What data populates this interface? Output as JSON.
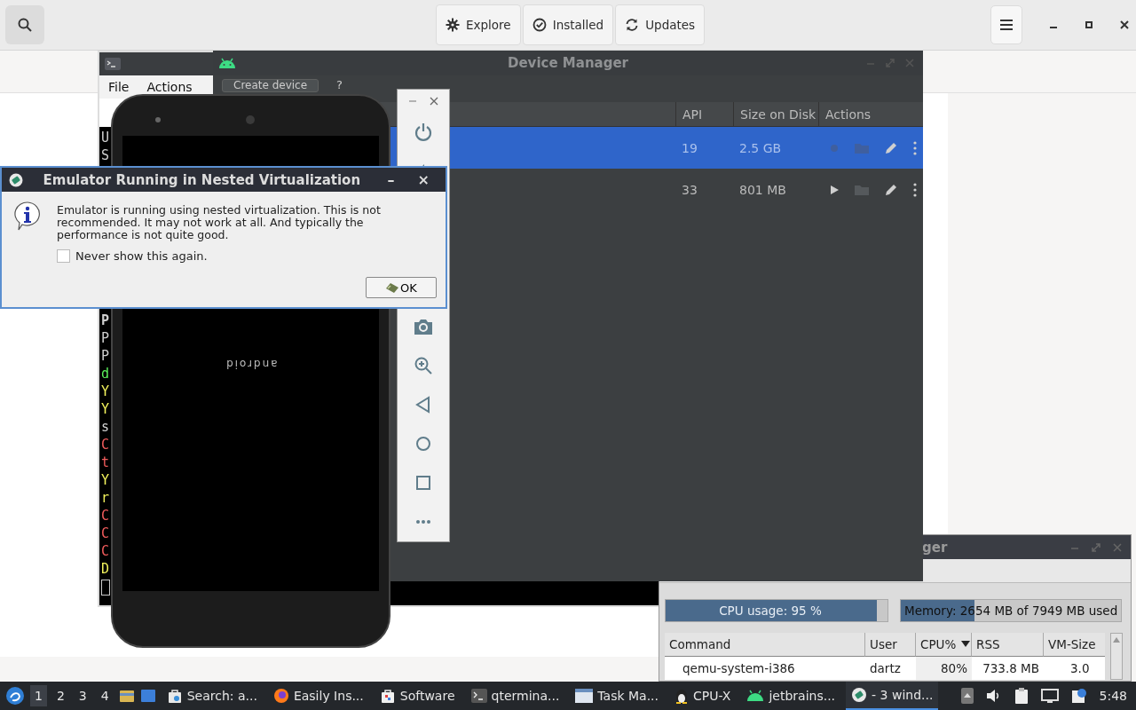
{
  "software_app": {
    "tabs": [
      {
        "label": "Explore",
        "selected": false
      },
      {
        "label": "Installed",
        "selected": false
      },
      {
        "label": "Updates",
        "selected": false
      }
    ]
  },
  "terminal": {
    "menu": [
      "File",
      "Actions"
    ],
    "lines_top": [
      {
        "text": "U",
        "color": "#d0d0d0"
      },
      {
        "text": "S",
        "color": "#d0d0d0"
      }
    ],
    "lines_bottom": [
      {
        "text": "P",
        "color": "#d0d0d0"
      },
      {
        "text": "P",
        "color": "#d0d0d0"
      },
      {
        "text": "P",
        "color": "#d0d0d0"
      },
      {
        "text": "d",
        "color": "#5cf25c"
      },
      {
        "text": "Y",
        "color": "#f2f25c"
      },
      {
        "text": "Y",
        "color": "#f2f25c"
      },
      {
        "text": "s",
        "color": "#d0d0d0"
      },
      {
        "text": "C",
        "color": "#f25c5c"
      },
      {
        "text": "t",
        "color": "#f25c5c"
      },
      {
        "text": "Y",
        "color": "#f2f25c"
      },
      {
        "text": "r",
        "color": "#f2f25c"
      },
      {
        "text": "C",
        "color": "#f25c5c"
      },
      {
        "text": "C",
        "color": "#f25c5c"
      },
      {
        "text": "C",
        "color": "#f25c5c"
      },
      {
        "text": "D",
        "color": "#f2f25c"
      }
    ]
  },
  "device_manager": {
    "title": "Device Manager",
    "toolbar": {
      "create": "Create device",
      "help": "?"
    },
    "columns": [
      "API",
      "Size on Disk",
      "Actions"
    ],
    "rows": [
      {
        "api": "19",
        "size": "2.5 GB",
        "selected": true
      },
      {
        "api": "33",
        "size": "801 MB",
        "selected": false
      }
    ]
  },
  "phone": {
    "logo": "android"
  },
  "dialog": {
    "title": "Emulator Running in Nested Virtualization",
    "minimize": "–",
    "close": "×",
    "message": "Emulator is running using nested virtualization. This is not recommended. It may not work at all. And typically the performance is not quite good.",
    "checkbox": {
      "label": "Never show this again.",
      "checked": false
    },
    "ok": "OK"
  },
  "task_manager": {
    "title": "ger",
    "cpu": {
      "label": "CPU usage: 95 %",
      "level": 0.95
    },
    "memory": {
      "label": "Memory: 2654 MB of 7949 MB used",
      "level": 0.334
    },
    "columns": [
      {
        "label": "Command",
        "sorted": false
      },
      {
        "label": "User",
        "sorted": false
      },
      {
        "label": "CPU%",
        "sorted": true
      },
      {
        "label": "RSS",
        "sorted": false
      },
      {
        "label": "VM-Size",
        "sorted": false
      }
    ],
    "rows": [
      {
        "cells": [
          "qemu-system-i386",
          "dartz",
          "80%",
          "733.8 MB",
          "3.0"
        ]
      }
    ]
  },
  "taskbar": {
    "workspaces": [
      {
        "label": "1",
        "selected": true
      },
      {
        "label": "2",
        "selected": false
      },
      {
        "label": "3",
        "selected": false
      },
      {
        "label": "4",
        "selected": false
      }
    ],
    "tasks": [
      {
        "label": "Search: a...",
        "kind": "search",
        "selected": false
      },
      {
        "label": "Easily Ins...",
        "kind": "firefox",
        "selected": false
      },
      {
        "label": "Software",
        "kind": "software",
        "selected": false
      },
      {
        "label": "qtermina...",
        "kind": "terminal",
        "selected": false
      },
      {
        "label": "Task Ma...",
        "kind": "window",
        "selected": false
      },
      {
        "label": "CPU-X",
        "kind": "penguin",
        "selected": false
      },
      {
        "label": "jetbrains...",
        "kind": "android",
        "selected": false
      },
      {
        "label": "- 3 wind...",
        "kind": "emulator",
        "selected": true
      }
    ],
    "clock": "5:48"
  }
}
